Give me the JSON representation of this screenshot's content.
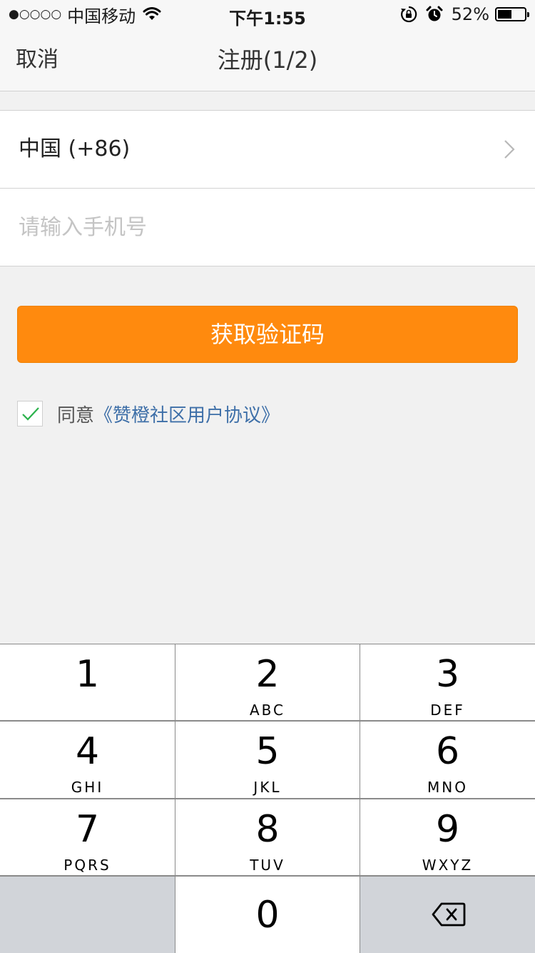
{
  "status_bar": {
    "signal": "●○○○○",
    "carrier": "中国移动",
    "time": "下午1:55",
    "battery_percent": "52%",
    "battery_level": 0.52
  },
  "nav": {
    "cancel_label": "取消",
    "title": "注册(1/2)"
  },
  "form": {
    "country_label": "中国 (+86)",
    "phone_placeholder": "请输入手机号",
    "phone_value": ""
  },
  "primary_button": {
    "label": "获取验证码",
    "color": "#ff8a0e"
  },
  "agreement": {
    "checked": true,
    "prefix": "同意",
    "link_text": "《赞橙社区用户协议》",
    "link_color": "#3e6fa8",
    "check_color": "#2bb24c"
  },
  "keypad": {
    "keys": [
      {
        "digit": "1",
        "letters": ""
      },
      {
        "digit": "2",
        "letters": "ABC"
      },
      {
        "digit": "3",
        "letters": "DEF"
      },
      {
        "digit": "4",
        "letters": "GHI"
      },
      {
        "digit": "5",
        "letters": "JKL"
      },
      {
        "digit": "6",
        "letters": "MNO"
      },
      {
        "digit": "7",
        "letters": "PQRS"
      },
      {
        "digit": "8",
        "letters": "TUV"
      },
      {
        "digit": "9",
        "letters": "WXYZ"
      },
      {
        "digit": "0",
        "letters": ""
      }
    ],
    "delete_icon": "backspace-icon"
  }
}
